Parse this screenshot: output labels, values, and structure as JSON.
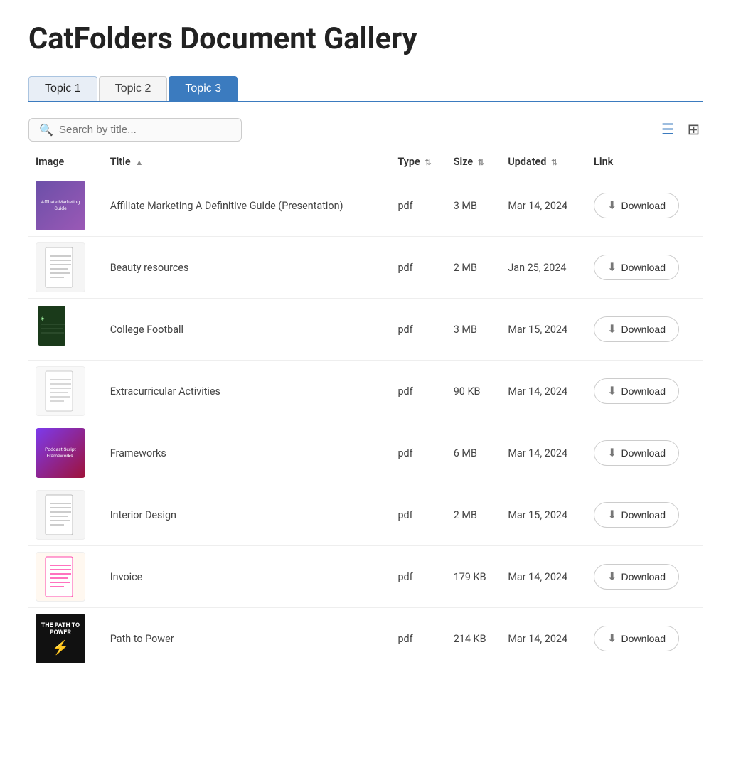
{
  "page": {
    "title": "CatFolders Document Gallery"
  },
  "tabs": [
    {
      "id": "topic1",
      "label": "Topic 1",
      "active": true,
      "style": "active"
    },
    {
      "id": "topic2",
      "label": "Topic 2",
      "active": false,
      "style": "normal"
    },
    {
      "id": "topic3",
      "label": "Topic 3",
      "active": false,
      "style": "active-blue"
    }
  ],
  "search": {
    "placeholder": "Search by title..."
  },
  "view_toggle": {
    "list_label": "List view",
    "grid_label": "Grid view"
  },
  "table": {
    "columns": [
      {
        "key": "image",
        "label": "Image"
      },
      {
        "key": "title",
        "label": "Title",
        "sortable": true,
        "sort_dir": "asc"
      },
      {
        "key": "type",
        "label": "Type",
        "sortable": true
      },
      {
        "key": "size",
        "label": "Size",
        "sortable": true
      },
      {
        "key": "updated",
        "label": "Updated",
        "sortable": true
      },
      {
        "key": "link",
        "label": "Link"
      }
    ],
    "rows": [
      {
        "id": 1,
        "title": "Affiliate Marketing A Definitive Guide (Presentation)",
        "type": "pdf",
        "size": "3 MB",
        "updated": "Mar 14, 2024",
        "thumb_style": "affiliate",
        "thumb_text": "Affiliate Marketing Guide"
      },
      {
        "id": 2,
        "title": "Beauty resources",
        "type": "pdf",
        "size": "2 MB",
        "updated": "Jan 25, 2024",
        "thumb_style": "beauty",
        "thumb_text": ""
      },
      {
        "id": 3,
        "title": "College Football",
        "type": "pdf",
        "size": "3 MB",
        "updated": "Mar 15, 2024",
        "thumb_style": "football",
        "thumb_text": ""
      },
      {
        "id": 4,
        "title": "Extracurricular Activities",
        "type": "pdf",
        "size": "90 KB",
        "updated": "Mar 14, 2024",
        "thumb_style": "extra",
        "thumb_text": ""
      },
      {
        "id": 5,
        "title": "Frameworks",
        "type": "pdf",
        "size": "6 MB",
        "updated": "Mar 14, 2024",
        "thumb_style": "frameworks",
        "thumb_text": "Podcast Script Frameworks."
      },
      {
        "id": 6,
        "title": "Interior Design",
        "type": "pdf",
        "size": "2 MB",
        "updated": "Mar 15, 2024",
        "thumb_style": "interior",
        "thumb_text": ""
      },
      {
        "id": 7,
        "title": "Invoice",
        "type": "pdf",
        "size": "179 KB",
        "updated": "Mar 14, 2024",
        "thumb_style": "invoice",
        "thumb_text": ""
      },
      {
        "id": 8,
        "title": "Path to Power",
        "type": "pdf",
        "size": "214 KB",
        "updated": "Mar 14, 2024",
        "thumb_style": "power",
        "thumb_text": "THE PATH TO POWER ⚡"
      }
    ],
    "download_label": "Download"
  }
}
